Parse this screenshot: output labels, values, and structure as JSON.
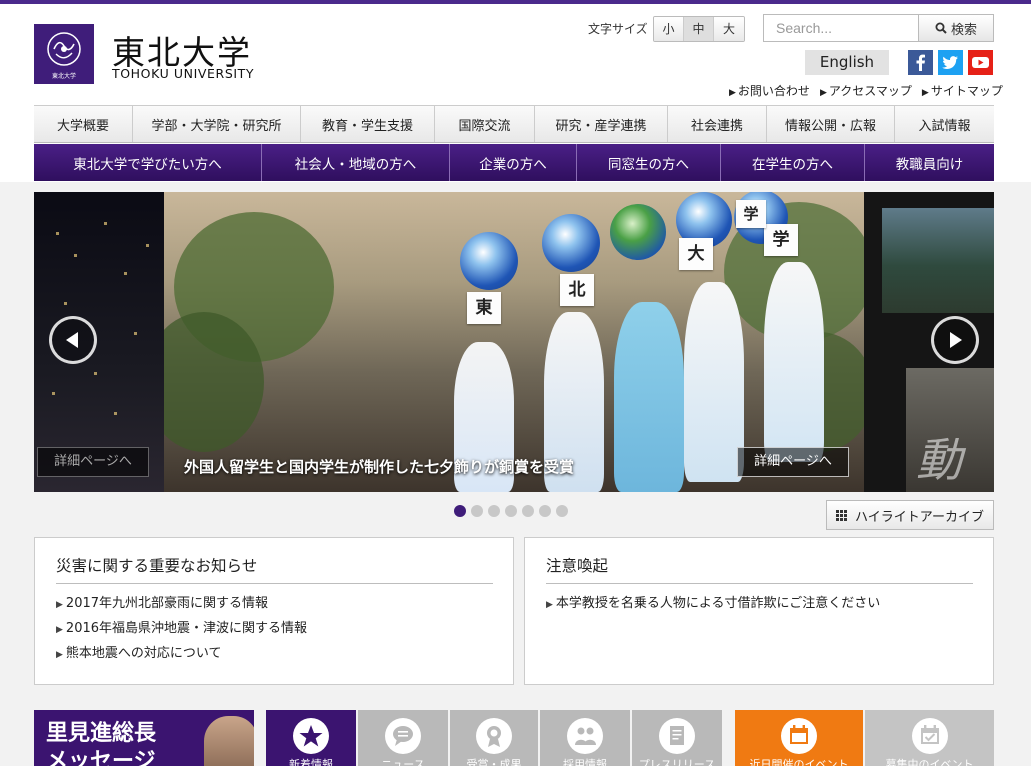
{
  "header": {
    "logo_jp": "東北大学",
    "logo_en": "TOHOKU UNIVERSITY",
    "seal_text": "東北大学",
    "font_size": {
      "label": "文字サイズ",
      "small": "小",
      "medium": "中",
      "large": "大",
      "active": "medium"
    },
    "search": {
      "placeholder": "Search...",
      "button_label": "検索"
    },
    "english_label": "English",
    "social": [
      "facebook-icon",
      "twitter-icon",
      "youtube-icon"
    ],
    "utility_links": [
      "お問い合わせ",
      "アクセスマップ",
      "サイトマップ"
    ]
  },
  "global_nav": [
    "大学概要",
    "学部・大学院・研究所",
    "教育・学生支援",
    "国際交流",
    "研究・産学連携",
    "社会連携",
    "情報公開・広報",
    "入試情報"
  ],
  "audience_nav": [
    "東北大学で学びたい方へ",
    "社会人・地域の方へ",
    "企業の方へ",
    "同窓生の方へ",
    "在学生の方へ",
    "教職員向け"
  ],
  "slider": {
    "caption": "外国人留学生と国内学生が制作した七夕飾りが銅賞を受賞",
    "detail_label": "詳細ページへ",
    "sign_chars": [
      "東",
      "北",
      "大",
      "学",
      "学"
    ],
    "right_preview_char": "動",
    "dot_count": 7,
    "active_dot": 0
  },
  "archive_button": "ハイライトアーカイブ",
  "disaster_notices": {
    "title": "災害に関する重要なお知らせ",
    "items": [
      "2017年九州北部豪雨に関する情報",
      "2016年福島県沖地震・津波に関する情報",
      "熊本地震への対応について"
    ]
  },
  "caution_notices": {
    "title": "注意喚起",
    "items": [
      "本学教授を名乗る人物による寸借詐欺にご注意ください"
    ]
  },
  "president": {
    "line1": "里見進総長",
    "line2": "メッセージ"
  },
  "news_tabs": [
    {
      "label": "新着情報",
      "color": "#3b1470",
      "active": true
    },
    {
      "label": "ニュース",
      "color": "#b9b9b9",
      "active": false
    },
    {
      "label": "受賞・成果",
      "color": "#b9b9b9",
      "active": false
    },
    {
      "label": "採用情報",
      "color": "#b9b9b9",
      "active": false
    },
    {
      "label": "プレスリリース",
      "color": "#b9b9b9",
      "active": false
    }
  ],
  "event_tabs": [
    {
      "label": "近日開催のイベント",
      "color": "#f07a12",
      "active": true
    },
    {
      "label": "募集中のイベント",
      "color": "#c4c4c4",
      "active": false
    }
  ],
  "colors": {
    "brand": "#3f1d7a",
    "accent_orange": "#f07a12"
  }
}
